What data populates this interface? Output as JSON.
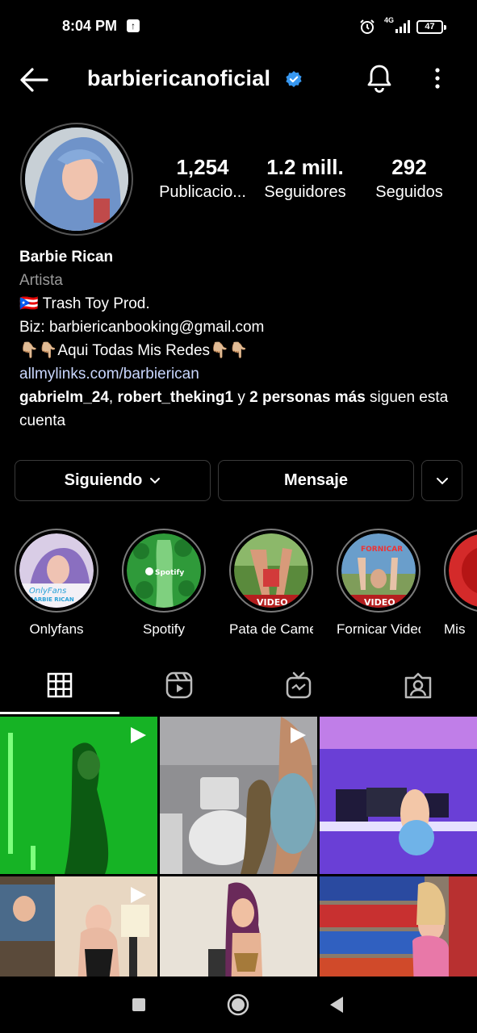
{
  "status_bar": {
    "time": "8:04 PM",
    "network": "4G",
    "battery": "47",
    "icons": [
      "upload-notification-icon",
      "alarm-icon",
      "signal-icon",
      "battery-icon"
    ]
  },
  "header": {
    "username": "barbiericanoficial",
    "icons": [
      "back-arrow-icon",
      "verified-badge-icon",
      "bell-icon",
      "more-vertical-icon"
    ]
  },
  "profile": {
    "stats": [
      {
        "value": "1,254",
        "label": "Publicacio..."
      },
      {
        "value": "1.2 mill.",
        "label": "Seguidores"
      },
      {
        "value": "292",
        "label": "Seguidos"
      }
    ],
    "name": "Barbie Rican",
    "category": "Artista",
    "bio_line1": "🇵🇷 Trash Toy Prod.",
    "bio_line2": "Biz: barbiericanbooking@gmail.com",
    "bio_line3": "👇🏼👇🏼Aqui Todas Mis Redes👇🏼👇🏼",
    "link": "allmylinks.com/barbierican",
    "followers_user1": "gabrielm_24",
    "followers_sep": ", ",
    "followers_user2": "robert_theking1",
    "followers_mid": " y ",
    "followers_more": "2 personas más",
    "followers_tail": " siguen esta cuenta"
  },
  "actions": {
    "following": "Siguiendo",
    "message": "Mensaje"
  },
  "highlights": [
    {
      "label": "Onlyfans"
    },
    {
      "label": "Spotify"
    },
    {
      "label": "Pata de Came..."
    },
    {
      "label": "Fornicar Video"
    },
    {
      "label": "Mis"
    }
  ],
  "highlight_texts": {
    "onlyfans": "OnlyFans",
    "onlyfans_sub": "BARBIE RICAN",
    "spotify": "Spotify",
    "video": "VIDEO",
    "fornicar": "FORNICAR"
  },
  "tabs": [
    "grid-icon",
    "reels-icon",
    "igtv-icon",
    "tagged-icon"
  ],
  "colors": {
    "background": "#000000",
    "verified": "#3797f0",
    "link": "#c9d7ff",
    "secondary_text": "#9a9a9a"
  }
}
